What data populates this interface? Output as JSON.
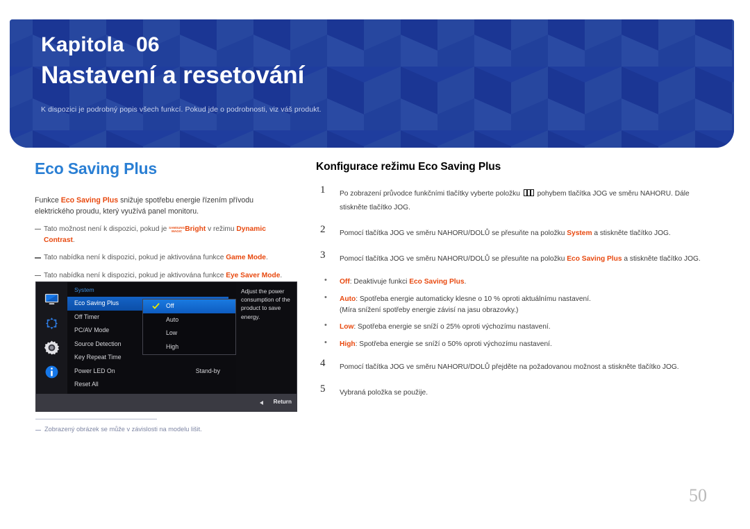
{
  "banner": {
    "chapter_label": "Kapitola  06",
    "title": "Nastavení a resetování",
    "subtitle": "K dispozici je podrobný popis všech funkcí. Pokud jde o podrobnosti, viz váš produkt.",
    "bg_color": "#1f3d9e"
  },
  "left": {
    "section_title": "Eco Saving Plus",
    "intro_a": "Funkce ",
    "intro_kw": "Eco Saving Plus",
    "intro_b": " snižuje spotřebu energie řízením přívodu elektrického proudu, který využívá panel monitoru.",
    "note1_a": "Tato možnost není k dispozici, pokud je ",
    "note1_logo_line1": "SAMSUNG",
    "note1_logo_line2": "MAGIC",
    "note1_bright": "Bright",
    "note1_b": " v režimu ",
    "note1_kw": "Dynamic Contrast",
    "note1_c": ".",
    "note2_a": "Tato nabídka není k dispozici, pokud je aktivována funkce ",
    "note2_kw": "Game Mode",
    "note2_b": ".",
    "note3_a": "Tato nabídka není k dispozici, pokud je aktivována funkce ",
    "note3_kw": "Eye Saver Mode",
    "note3_b": ".",
    "footnote": "Zobrazený obrázek se může v závislosti na modelu lišit."
  },
  "osd": {
    "category": "System",
    "icons": [
      "display-icon",
      "screen-adjust-icon",
      "gear-icon",
      "information-icon"
    ],
    "menu_items": [
      {
        "label": "Eco Saving Plus",
        "value": "",
        "selected": true
      },
      {
        "label": "Off Timer",
        "value": "",
        "selected": false
      },
      {
        "label": "PC/AV Mode",
        "value": "",
        "selected": false
      },
      {
        "label": "Source Detection",
        "value": "",
        "selected": false
      },
      {
        "label": "Key Repeat Time",
        "value": "",
        "selected": false
      },
      {
        "label": "Power LED On",
        "value": "Stand-by",
        "selected": false
      },
      {
        "label": "Reset All",
        "value": "",
        "selected": false
      }
    ],
    "submenu_items": [
      {
        "label": "Off",
        "selected": true
      },
      {
        "label": "Auto",
        "selected": false
      },
      {
        "label": "Low",
        "selected": false
      },
      {
        "label": "High",
        "selected": false
      }
    ],
    "description": "Adjust the power consumption of the product to save energy.",
    "return_label": "Return",
    "accent_color": "#1463c6",
    "check_color": "#e8e800"
  },
  "right": {
    "section_title": "Konfigurace režimu Eco Saving Plus",
    "steps": [
      {
        "num": "1",
        "text_a": "Po zobrazení průvodce funkčními tlačítky vyberte položku ",
        "icon": "menu-glyph-icon",
        "text_b": " pohybem tlačítka JOG ve směru NAHORU. Dále stiskněte tlačítko JOG."
      },
      {
        "num": "2",
        "text_a": "Pomocí tlačítka JOG ve směru NAHORU/DOLŮ se přesuňte na položku ",
        "kw": "System",
        "text_b": " a stiskněte tlačítko JOG."
      },
      {
        "num": "3",
        "text_a": "Pomocí tlačítka JOG ve směru NAHORU/DOLŮ se přesuňte na položku ",
        "kw": "Eco Saving Plus",
        "text_b": " a stiskněte tlačítko JOG."
      }
    ],
    "bullets": [
      {
        "kw": "Off",
        "text": ": Deaktivuje funkci ",
        "kw2": "Eco Saving Plus",
        "text2": ".",
        "sub": ""
      },
      {
        "kw": "Auto",
        "text": ": Spotřeba energie automaticky klesne o 10 % oproti aktuálnímu nastavení.",
        "kw2": "",
        "text2": "",
        "sub": "(Míra snížení spotřeby energie závisí na jasu obrazovky.)"
      },
      {
        "kw": "Low",
        "text": ": Spotřeba energie se sníží o 25% oproti výchozímu nastavení.",
        "kw2": "",
        "text2": "",
        "sub": ""
      },
      {
        "kw": "High",
        "text": ": Spotřeba energie se sníží o 50% oproti výchozímu nastavení.",
        "kw2": "",
        "text2": "",
        "sub": ""
      }
    ],
    "step4": {
      "num": "4",
      "text": "Pomocí tlačítka JOG ve směru NAHORU/DOLŮ přejděte na požadovanou možnost a stiskněte tlačítko JOG."
    },
    "step5": {
      "num": "5",
      "text": "Vybraná položka se použije."
    }
  },
  "page_number": "50"
}
